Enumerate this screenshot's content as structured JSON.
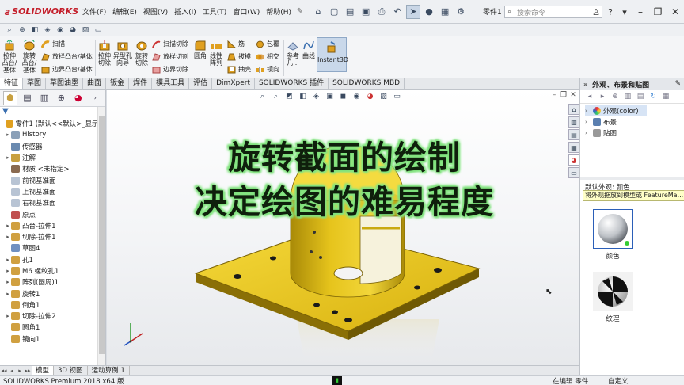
{
  "app": {
    "brand": "SOLIDWORKS",
    "menu": [
      "文件(F)",
      "编辑(E)",
      "视图(V)",
      "插入(I)",
      "工具(T)",
      "窗口(W)",
      "帮助(H)"
    ],
    "document": "零件1 *",
    "search_placeholder": "搜索命令",
    "help_icon": "?"
  },
  "ribbon": {
    "extrude_boss": "拉伸\n凸台/\n基体",
    "revolve_boss": "旋转\n凸台/\n基体",
    "sweep": "扫描",
    "loft_boss": "放样凸台/基体",
    "boundary_boss": "边界凸台/基体",
    "extrude_cut": "拉伸\n切除",
    "hole_wizard": "异型孔\n向导",
    "revolve_cut": "旋转\n切除",
    "swept_cut": "扫描切除",
    "lofted_cut": "放样切割",
    "boundary_cut": "边界切除",
    "fillet": "圆角",
    "linear_pattern": "线性\n阵列",
    "rib": "筋",
    "draft": "拔模",
    "shell": "抽壳",
    "wrap": "包覆",
    "intersect": "相交",
    "mirror": "镜向",
    "reference": "参考\n几...",
    "curves": "曲线",
    "instant3d": "Instant3D"
  },
  "tabs": [
    "特征",
    "草图",
    "草图油墨",
    "曲面",
    "钣金",
    "焊件",
    "模具工具",
    "评估",
    "DimXpert",
    "SOLIDWORKS 插件",
    "SOLIDWORKS MBD"
  ],
  "feature_tree": [
    {
      "label": "零件1 (默认<<默认>_显示状",
      "exp": "",
      "color": "#e0a020",
      "indent": 0
    },
    {
      "label": "History",
      "exp": "▸",
      "color": "#8aa0b8",
      "indent": 1
    },
    {
      "label": "传感器",
      "exp": "",
      "color": "#6a8ab0",
      "indent": 1
    },
    {
      "label": "注解",
      "exp": "▸",
      "color": "#c8a040",
      "indent": 1
    },
    {
      "label": "材质 <未指定>",
      "exp": "",
      "color": "#8a6a50",
      "indent": 1
    },
    {
      "label": "前视基准面",
      "exp": "",
      "color": "#b8c4d4",
      "indent": 1
    },
    {
      "label": "上视基准面",
      "exp": "",
      "color": "#b8c4d4",
      "indent": 1
    },
    {
      "label": "右视基准面",
      "exp": "",
      "color": "#b8c4d4",
      "indent": 1
    },
    {
      "label": "原点",
      "exp": "",
      "color": "#c05050",
      "indent": 1
    },
    {
      "label": "凸台-拉伸1",
      "exp": "▸",
      "color": "#d0a040",
      "indent": 1
    },
    {
      "label": "切除-拉伸1",
      "exp": "▸",
      "color": "#d0a040",
      "indent": 1
    },
    {
      "label": "草图4",
      "exp": "",
      "color": "#7090c0",
      "indent": 1
    },
    {
      "label": "孔1",
      "exp": "▸",
      "color": "#d0a040",
      "indent": 1
    },
    {
      "label": "M6 螺纹孔1",
      "exp": "▸",
      "color": "#d0a040",
      "indent": 1
    },
    {
      "label": "阵列(圆周)1",
      "exp": "▸",
      "color": "#d0a040",
      "indent": 1
    },
    {
      "label": "旋转1",
      "exp": "▸",
      "color": "#d0a040",
      "indent": 1
    },
    {
      "label": "倒角1",
      "exp": "",
      "color": "#d0a040",
      "indent": 1
    },
    {
      "label": "切除-拉伸2",
      "exp": "▸",
      "color": "#d0a040",
      "indent": 1
    },
    {
      "label": "圆角1",
      "exp": "",
      "color": "#d0a040",
      "indent": 1
    },
    {
      "label": "镜向1",
      "exp": "",
      "color": "#d0a040",
      "indent": 1
    }
  ],
  "bottom_tabs": [
    "模型",
    "3D 视图",
    "运动算例 1"
  ],
  "status": {
    "product": "SOLIDWORKS Premium 2018 x64 版",
    "editing": "在编辑 零件",
    "custom": "自定义"
  },
  "overlay": {
    "line1": "旋转截面的绘制",
    "line2": "决定绘图的难易程度"
  },
  "task_pane": {
    "title": "外观、布景和贴图",
    "tree": [
      "外观(color)",
      "布景",
      "贴图"
    ],
    "default_label": "默认外观: 颜色",
    "tooltip": "将外观拖放到模型或 FeatureMa...",
    "swatches": [
      "颜色",
      "纹理"
    ]
  },
  "colors": {
    "model_gold": "#e8c317",
    "overlay_glow": "#7ee07b",
    "overlay_text": "#0f1f0c",
    "accent_red": "#c41e2a"
  }
}
